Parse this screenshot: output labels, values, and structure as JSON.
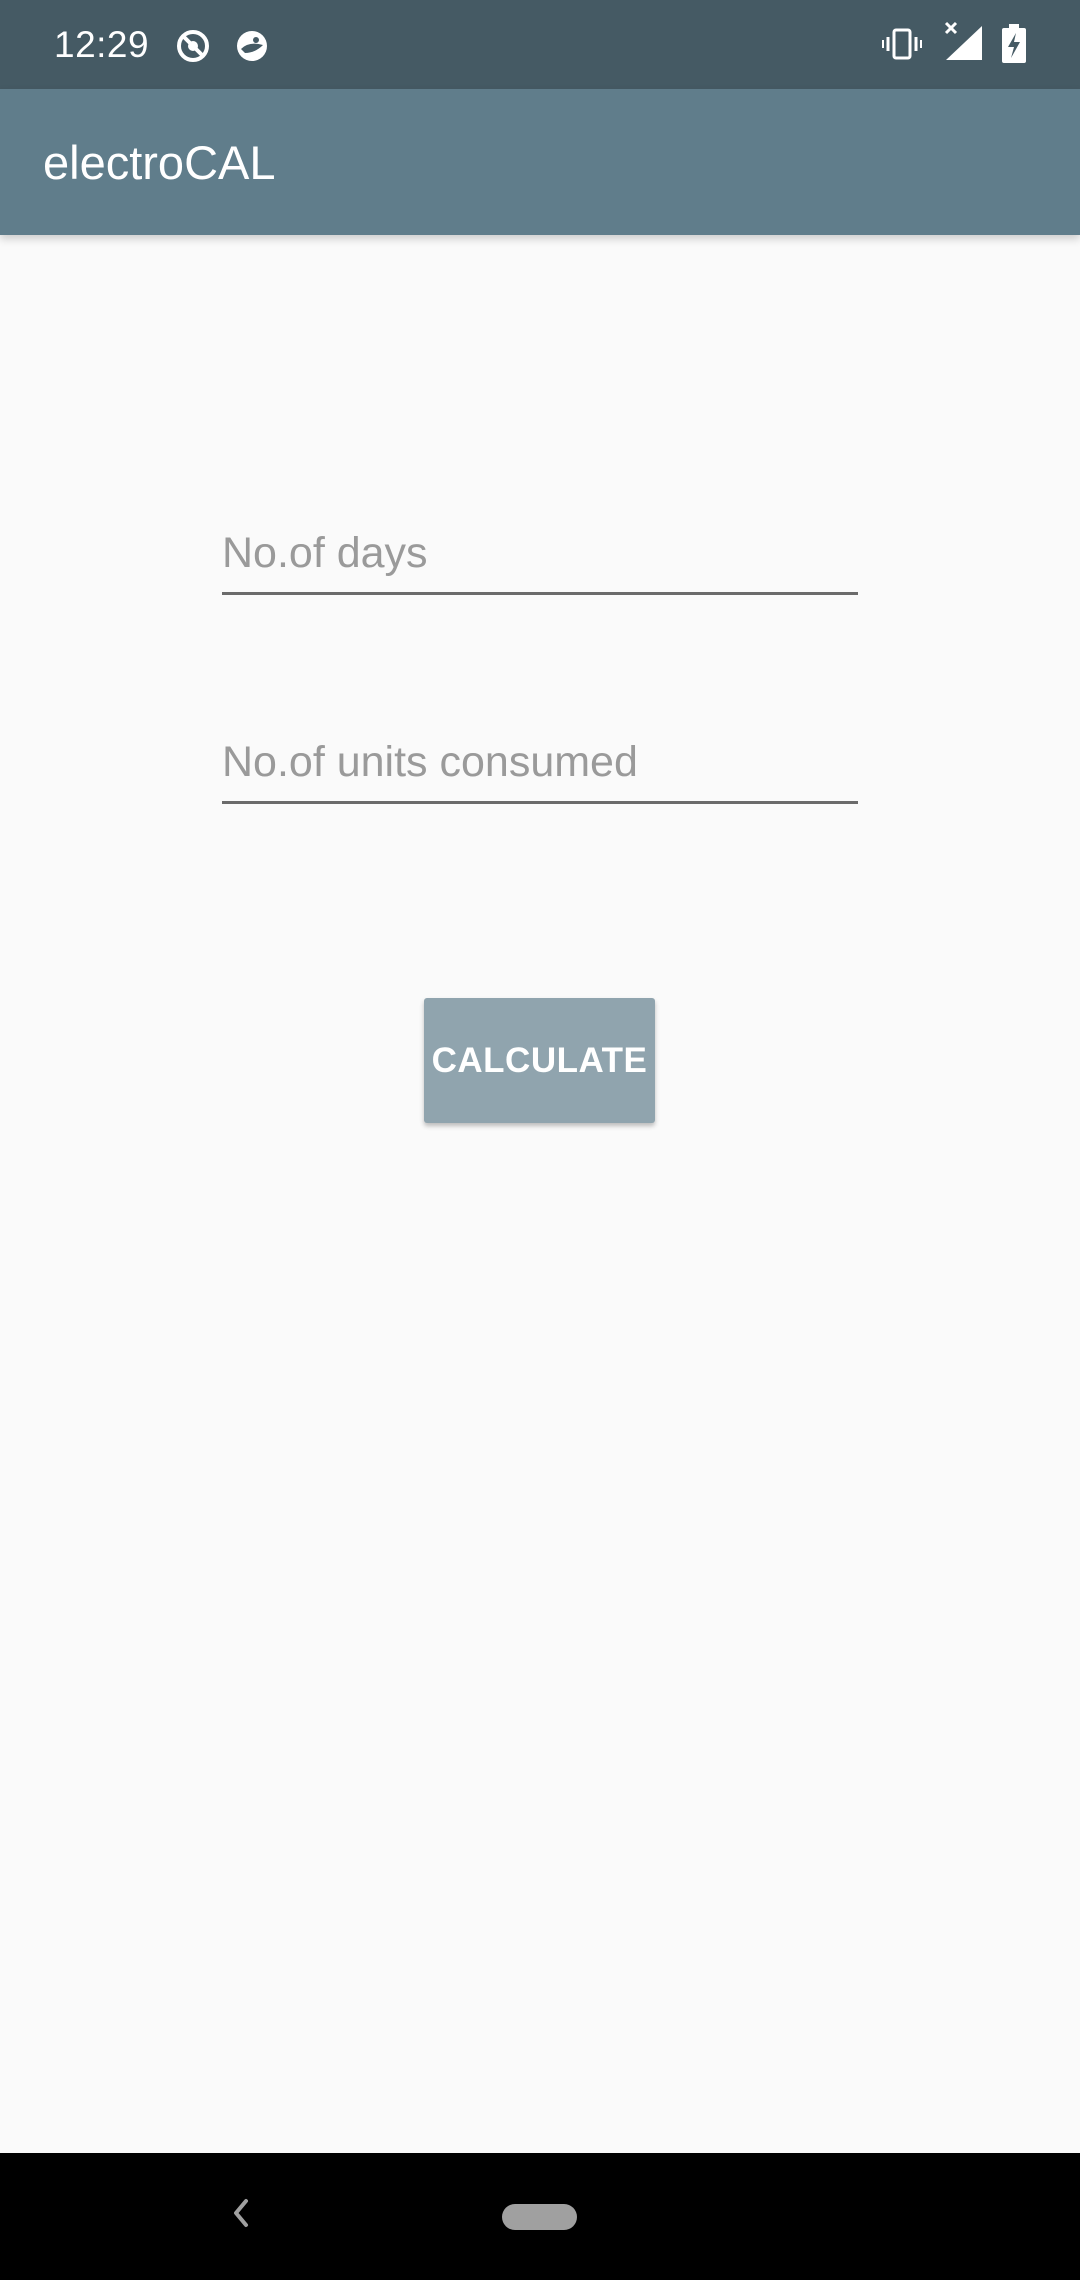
{
  "status_bar": {
    "time": "12:29",
    "left_icons": [
      "no-disturb-icon",
      "app-notification-icon"
    ],
    "right_icons": [
      "vibrate-icon",
      "signal-no-data-icon",
      "battery-charging-icon"
    ]
  },
  "app_bar": {
    "title": "electroCAL"
  },
  "form": {
    "days": {
      "placeholder": "No.of days",
      "value": ""
    },
    "units": {
      "placeholder": "No.of units consumed",
      "value": ""
    },
    "calculate_label": "CALCULATE"
  },
  "nav_bar": {
    "back_icon": "back-chevron-icon",
    "home_icon": "home-pill-icon"
  },
  "colors": {
    "status_bar": "#455a64",
    "app_bar": "#607d8b",
    "button": "#90a4ae",
    "background": "#fafafa",
    "nav_bar": "#000000"
  }
}
